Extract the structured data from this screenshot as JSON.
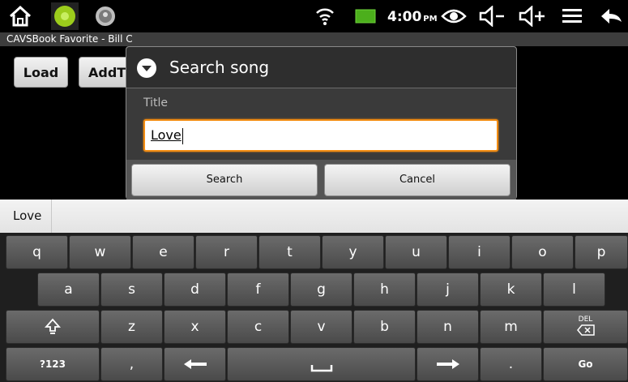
{
  "status_bar": {
    "time": "4:00",
    "ampm": "PM",
    "icons": [
      "home-icon",
      "app-icon-green",
      "app-icon-gray",
      "wifi-icon",
      "battery-icon",
      "eye-icon",
      "volume-down-icon",
      "volume-up-icon",
      "menu-icon",
      "back-icon"
    ]
  },
  "app": {
    "title": "CAVSBook Favorite - Bill C",
    "load_label": "Load",
    "addt_label": "AddT"
  },
  "dialog": {
    "title": "Search song",
    "field_label": "Title",
    "field_value": "Love",
    "search_label": "Search",
    "cancel_label": "Cancel"
  },
  "suggestion": {
    "word": "Love"
  },
  "keyboard": {
    "row1": [
      "q",
      "w",
      "e",
      "r",
      "t",
      "y",
      "u",
      "i",
      "o",
      "p"
    ],
    "row2": [
      "a",
      "s",
      "d",
      "f",
      "g",
      "h",
      "j",
      "k",
      "l"
    ],
    "row3": [
      "z",
      "x",
      "c",
      "v",
      "b",
      "n",
      "m"
    ],
    "sym_label": "?123",
    "comma": ",",
    "period": ".",
    "go_label": "Go",
    "del_label": "DEL"
  },
  "colors": {
    "focus_orange": "#f28c12",
    "accent_green": "#9ccc1c"
  }
}
